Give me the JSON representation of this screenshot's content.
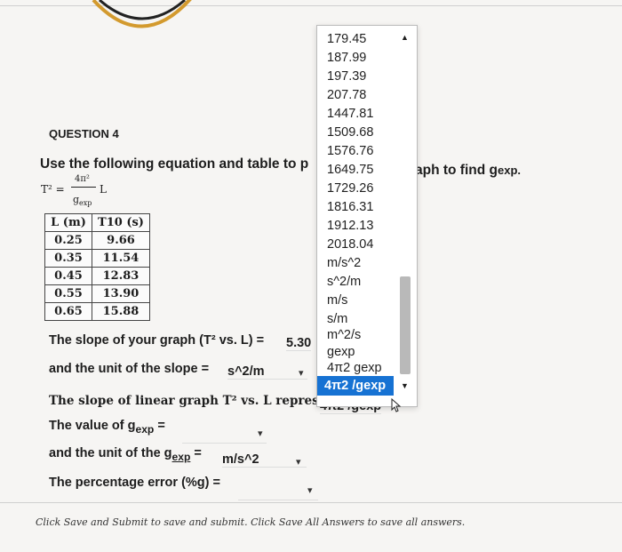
{
  "question": {
    "title": "QUESTION 4",
    "instruction_start": "Use the following equation and table to p",
    "instruction_end": "aph to find g",
    "instruction_end_sub": "exp.",
    "formula": {
      "lhs": "T² =",
      "numerator": "4π²",
      "var": "L",
      "denominator": "g",
      "denominator_sub": "exp"
    }
  },
  "table": {
    "headers": [
      "L (m)",
      "T10 (s)"
    ],
    "rows": [
      [
        "0.25",
        "9.66"
      ],
      [
        "0.35",
        "11.54"
      ],
      [
        "0.45",
        "12.83"
      ],
      [
        "0.55",
        "13.90"
      ],
      [
        "0.65",
        "15.88"
      ]
    ]
  },
  "lines": {
    "slope_label": "The slope of your graph (T² vs. L) =",
    "slope_value": "5.30",
    "unit_label": "and the unit of the slope =",
    "unit_value": "s^2/m",
    "represent_label": "The slope of linear graph T² vs. L represent",
    "represent_value": "4π2 /gexp",
    "gexp_label": "The value of g",
    "gexp_sub": "exp",
    "gexp_tail": "=",
    "gunit_label": "and the unit of the g",
    "gunit_sub": "exp",
    "gunit_tail": "=",
    "gunit_value": "m/s^2",
    "perc_label": "The percentage error (%g) ="
  },
  "dropdown": {
    "options": [
      "179.45",
      "187.99",
      "197.39",
      "207.78",
      "1447.81",
      "1509.68",
      "1576.76",
      "1649.75",
      "1729.26",
      "1816.31",
      "1912.13",
      "2018.04",
      "m/s^2",
      "s^2/m",
      "m/s",
      "s/m",
      "m^2/s",
      "gexp",
      "4π2 gexp"
    ],
    "selected": "4π2 /gexp"
  },
  "footer": "Click Save and Submit to save and submit. Click Save All Answers to save all answers."
}
